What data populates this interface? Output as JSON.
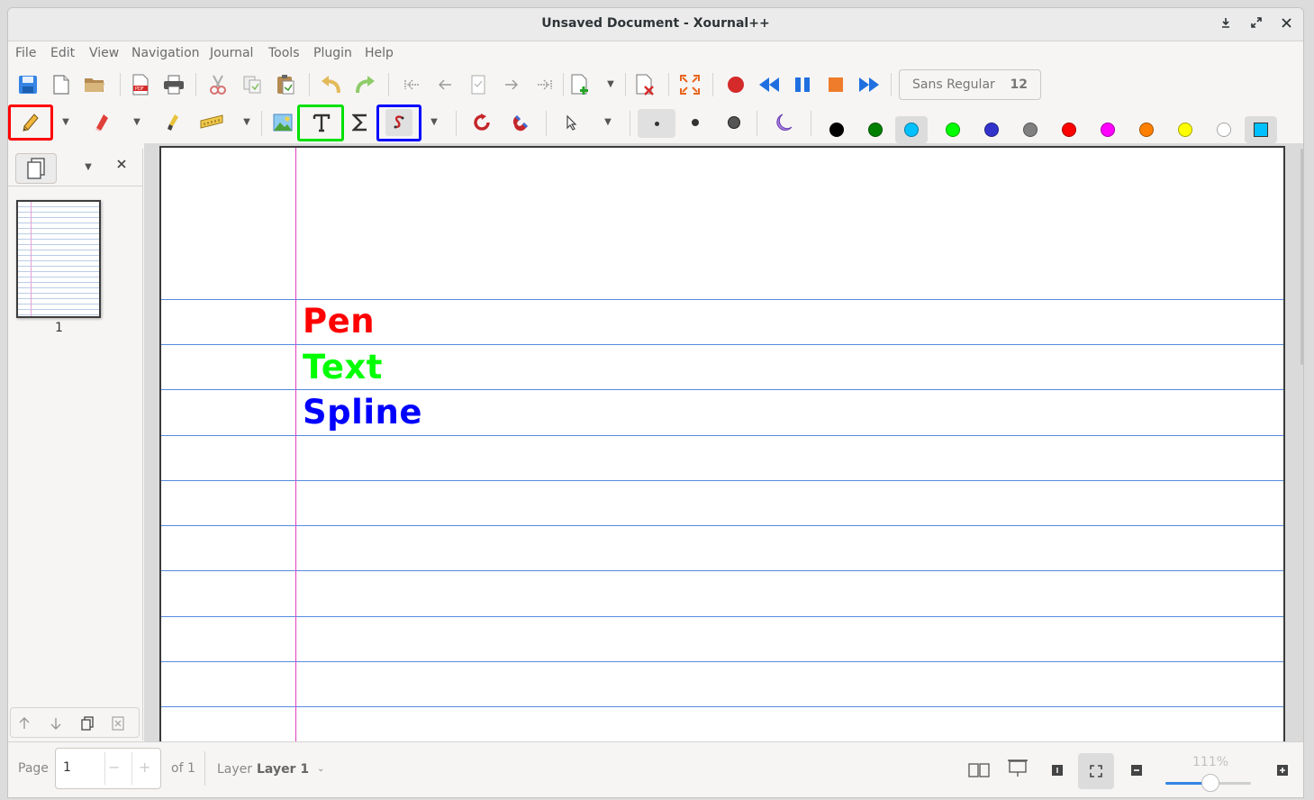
{
  "window": {
    "title": "Unsaved Document - Xournal++",
    "controls": [
      "minimize-icon",
      "maximize-icon",
      "close-icon"
    ]
  },
  "menu": [
    "File",
    "Edit",
    "View",
    "Navigation",
    "Journal",
    "Tools",
    "Plugin",
    "Help"
  ],
  "toolbar": {
    "font_name": "Sans Regular",
    "font_size": "12",
    "colors": [
      "#000000",
      "#008000",
      "#00c0ff",
      "#00ff00",
      "#3333cc",
      "#808080",
      "#ff0000",
      "#ff00ff",
      "#ff8000",
      "#ffff00",
      "#ffffff"
    ],
    "current_color": "#00c0ff",
    "highlight_colors": {
      "pen": "#ff0000",
      "text": "#00e000",
      "spline": "#0000ff"
    }
  },
  "sidebar": {
    "page_number": "1"
  },
  "page": {
    "texts": [
      {
        "label": "Pen",
        "color": "#ff0000"
      },
      {
        "label": "Text",
        "color": "#00ff00"
      },
      {
        "label": "Spline",
        "color": "#0000ff"
      }
    ]
  },
  "status": {
    "page_label": "Page",
    "page_value": "1",
    "of_label": "of 1",
    "layer_label": "Layer",
    "layer_value": "Layer 1",
    "zoom": "111%"
  }
}
